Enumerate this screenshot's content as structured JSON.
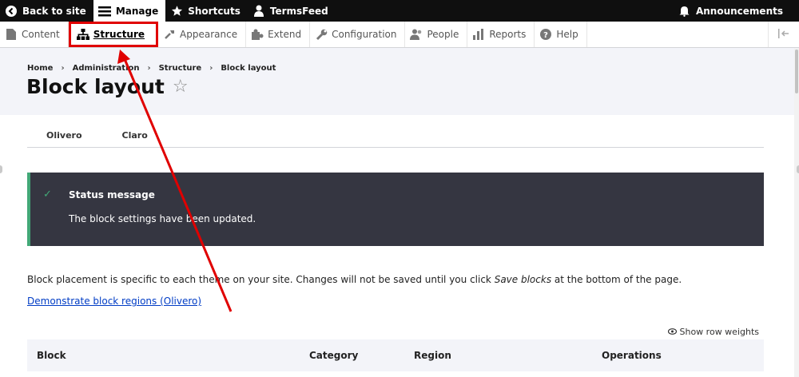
{
  "toolbar": {
    "back": "Back to site",
    "manage": "Manage",
    "shortcuts": "Shortcuts",
    "user": "TermsFeed",
    "announcements": "Announcements"
  },
  "tray": {
    "items": [
      {
        "label": "Content",
        "icon": "content-icon"
      },
      {
        "label": "Structure",
        "icon": "structure-icon"
      },
      {
        "label": "Appearance",
        "icon": "appearance-icon"
      },
      {
        "label": "Extend",
        "icon": "extend-icon"
      },
      {
        "label": "Configuration",
        "icon": "configuration-icon"
      },
      {
        "label": "People",
        "icon": "people-icon"
      },
      {
        "label": "Reports",
        "icon": "reports-icon"
      },
      {
        "label": "Help",
        "icon": "help-icon"
      }
    ],
    "active_index": 1
  },
  "breadcrumb": [
    "Home",
    "Administration",
    "Structure",
    "Block layout"
  ],
  "page": {
    "title": "Block layout"
  },
  "tabs": [
    "Olivero",
    "Claro"
  ],
  "status": {
    "title": "Status message",
    "body": "The block settings have been updated."
  },
  "description": {
    "before": "Block placement is specific to each theme on your site. Changes will not be saved until you click ",
    "em": "Save blocks",
    "after": " at the bottom of the page."
  },
  "demo_link": "Demonstrate block regions (Olivero)",
  "row_weights": "Show row weights",
  "table": {
    "headers": [
      "Block",
      "Category",
      "Region",
      "Operations"
    ]
  },
  "colors": {
    "highlight": "#e00000",
    "status_accent": "#42a877",
    "link": "#003cc5"
  }
}
